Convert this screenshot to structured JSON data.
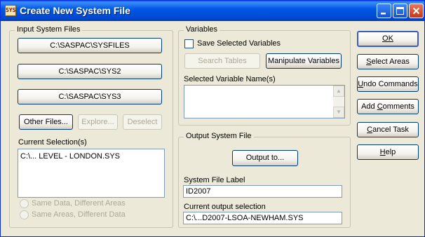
{
  "window": {
    "title": "Create New System File",
    "icon_text": "SYS"
  },
  "input_group": {
    "legend": "Input System Files",
    "files": [
      "C:\\SASPAC\\SYSFILES",
      "C:\\SASPAC\\SYS2",
      "C:\\SASPAC\\SYS3"
    ],
    "other_files": "Other Files...",
    "explore": "Explore...",
    "deselect": "Deselect",
    "current_label": "Current Selection(s)",
    "current_value": "C:\\... LEVEL - LONDON.SYS",
    "radio_same_data": "Same Data, Different Areas",
    "radio_same_areas": "Same Areas, Different Data"
  },
  "variables_group": {
    "legend": "Variables",
    "save_selected": "Save Selected Variables",
    "search_tables": "Search Tables",
    "manipulate": "Manipulate Variables",
    "selected_names_label": "Selected Variable Name(s)"
  },
  "output_group": {
    "legend": "Output System File",
    "output_to": "Output to...",
    "label_caption": "System File Label",
    "label_value": "ID2007",
    "current_caption": "Current output selection",
    "current_value": "C:\\...D2007-LSOA-NEWHAM.SYS"
  },
  "buttons": {
    "ok": "OK",
    "select_areas_pre": "",
    "select_areas_key": "S",
    "select_areas_post": "elect Areas",
    "undo_key": "U",
    "undo_post": "ndo Commands",
    "add_comments_pre": "Add ",
    "add_comments_key": "C",
    "add_comments_post": "omments",
    "cancel_key": "C",
    "cancel_post": "ancel Task",
    "help_key": "H",
    "help_post": "elp"
  }
}
